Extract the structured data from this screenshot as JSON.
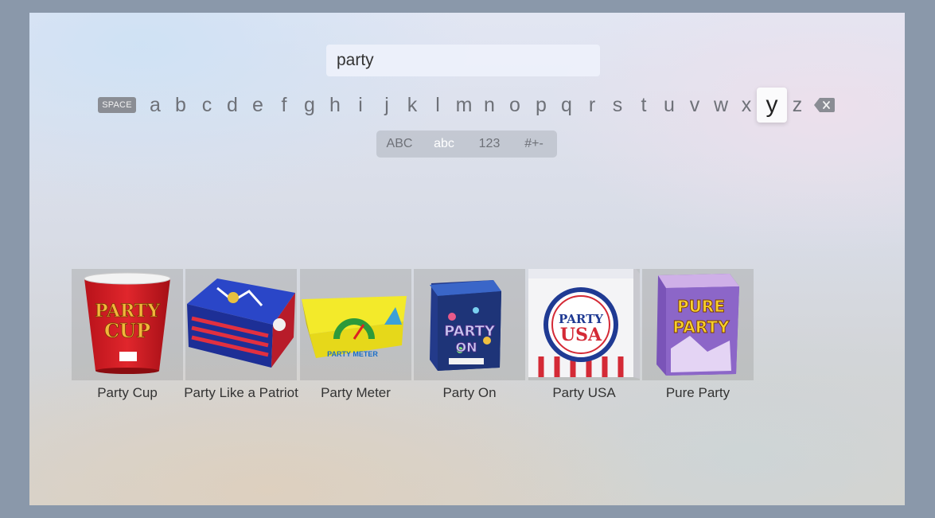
{
  "search": {
    "query": "party"
  },
  "keyboard": {
    "space_label": "SPACE",
    "letters": [
      "a",
      "b",
      "c",
      "d",
      "e",
      "f",
      "g",
      "h",
      "i",
      "j",
      "k",
      "l",
      "m",
      "n",
      "o",
      "p",
      "q",
      "r",
      "s",
      "t",
      "u",
      "v",
      "w",
      "x",
      "y",
      "z"
    ],
    "focused_key": "y",
    "delete_icon": "backspace-icon"
  },
  "modes": [
    {
      "label": "ABC",
      "active": false
    },
    {
      "label": "abc",
      "active": true
    },
    {
      "label": "123",
      "active": false
    },
    {
      "label": "#+-",
      "active": false
    }
  ],
  "results": [
    {
      "title": "Party Cup",
      "art_text": "PARTY CUP"
    },
    {
      "title": "Party Like a Patriot",
      "art_text": ""
    },
    {
      "title": "Party Meter",
      "art_text": "PARTY METER"
    },
    {
      "title": "Party On",
      "art_text": "PARTY ON"
    },
    {
      "title": "Party USA",
      "art_text": "PARTY USA"
    },
    {
      "title": "Pure Party",
      "art_text": "PURE PARTY"
    }
  ],
  "colors": {
    "focus_key_bg": "#fbfbfc",
    "space_key_bg": "#8a8d94"
  }
}
